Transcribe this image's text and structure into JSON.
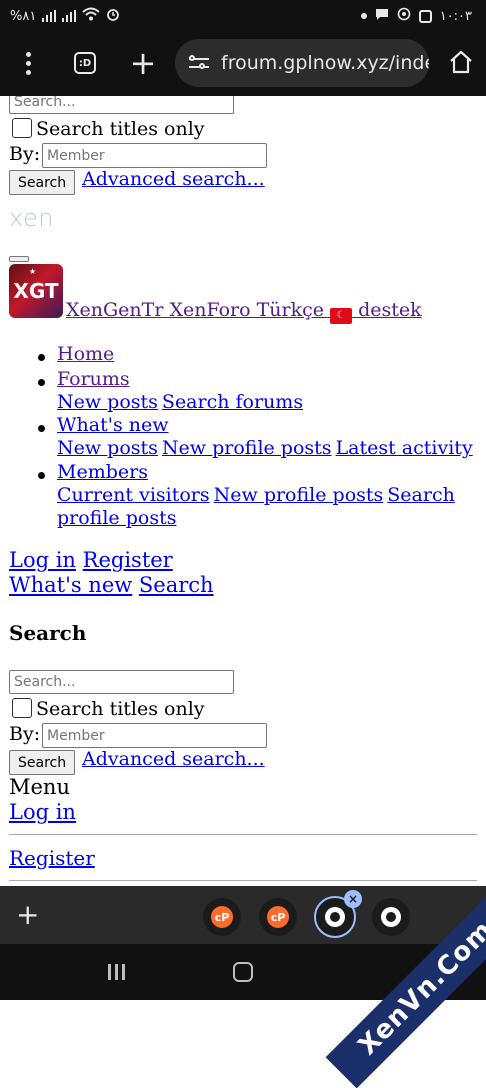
{
  "status_bar": {
    "battery": "%٨١",
    "time": "١٠:٠٣"
  },
  "browser": {
    "url": "froum.gplnow.xyz/inde",
    "tabs_icon_label": ":D",
    "bottom_tabs": [
      {
        "favicon": "cpanel-icon"
      },
      {
        "favicon": "cpanel-icon"
      },
      {
        "favicon": "globe-icon",
        "active": true
      },
      {
        "favicon": "globe-icon"
      }
    ]
  },
  "page": {
    "top_search": {
      "placeholder": "Search...",
      "titles_only_label": "Search titles only",
      "by_label": "By:",
      "member_placeholder": "Member",
      "submit_label": "Search",
      "advanced_link": "Advanced search..."
    },
    "logo_text": "xen",
    "site_link": "XenGenTr XenForo Türkçe",
    "site_link_suffix": "destek",
    "avatar_text": "XGT",
    "nav": {
      "home": "Home",
      "forums": "Forums",
      "forums_sub": [
        "New posts",
        "Search forums"
      ],
      "whats_new": "What's new",
      "whats_new_sub": [
        "New posts",
        "New profile posts",
        "Latest activity"
      ],
      "members": "Members",
      "members_sub": [
        "Current visitors",
        "New profile posts",
        "Search profile posts"
      ]
    },
    "account": {
      "login": "Log in",
      "register": "Register",
      "whats_new": "What's new",
      "search": "Search"
    },
    "search_section": {
      "heading": "Search",
      "placeholder": "Search...",
      "titles_only_label": "Search titles only",
      "by_label": "By:",
      "member_placeholder": "Member",
      "submit_label": "Search",
      "advanced_link": "Advanced search..."
    },
    "menu": {
      "label": "Menu",
      "login": "Log in",
      "register": "Register"
    }
  },
  "watermark": "XenVn.Com"
}
